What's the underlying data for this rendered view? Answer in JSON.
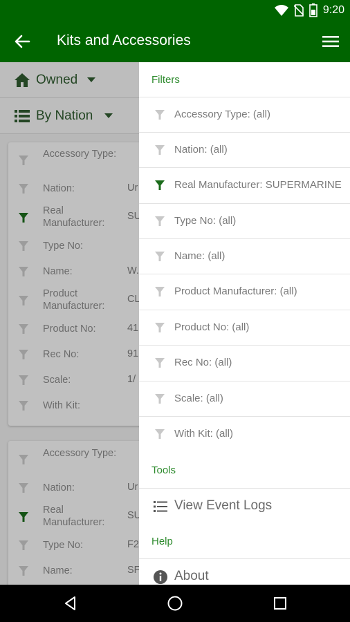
{
  "status_bar": {
    "time": "9:20"
  },
  "app_bar": {
    "title": "Kits and Accessories"
  },
  "page": {
    "owned_label": "Owned",
    "by_nation_label": "By Nation",
    "cards": [
      {
        "rows": [
          {
            "label": "Accessory Type:",
            "value": ""
          },
          {
            "label": "Nation:",
            "value": "Ur"
          },
          {
            "label": "Real Manufacturer:",
            "value": "SU"
          },
          {
            "label": "Type No:",
            "value": ""
          },
          {
            "label": "Name:",
            "value": "W."
          },
          {
            "label": "Product Manufacturer:",
            "value": "CL"
          },
          {
            "label": "Product No:",
            "value": "41"
          },
          {
            "label": "Rec No:",
            "value": "91"
          },
          {
            "label": "Scale:",
            "value": "1/"
          },
          {
            "label": "With Kit:",
            "value": ""
          }
        ]
      },
      {
        "rows": [
          {
            "label": "Accessory Type:",
            "value": ""
          },
          {
            "label": "Nation:",
            "value": "Ur"
          },
          {
            "label": "Real Manufacturer:",
            "value": "SU"
          },
          {
            "label": "Type No:",
            "value": "F2"
          },
          {
            "label": "Name:",
            "value": "SF"
          }
        ]
      }
    ]
  },
  "drawer": {
    "filters_header": "Filters",
    "filters": [
      {
        "label": "Accessory Type: (all)",
        "active": false
      },
      {
        "label": "Nation: (all)",
        "active": false
      },
      {
        "label": "Real Manufacturer: SUPERMARINE",
        "active": true
      },
      {
        "label": "Type No: (all)",
        "active": false
      },
      {
        "label": "Name: (all)",
        "active": false
      },
      {
        "label": "Product Manufacturer: (all)",
        "active": false
      },
      {
        "label": "Product No: (all)",
        "active": false
      },
      {
        "label": "Rec No: (all)",
        "active": false
      },
      {
        "label": "Scale: (all)",
        "active": false
      },
      {
        "label": "With Kit: (all)",
        "active": false
      }
    ],
    "tools_header": "Tools",
    "view_event_logs": "View Event Logs",
    "help_header": "Help",
    "about": "About"
  },
  "colors": {
    "app_bar": "#006400",
    "accent": "#2e8b2e",
    "filter_active": "#1b6b1b",
    "filter_inactive": "#c8c8c8"
  },
  "icons": [
    "back-arrow-icon",
    "hamburger-menu-icon",
    "home-icon",
    "list-icon",
    "filter-icon",
    "info-icon",
    "wifi-icon",
    "no-sim-icon",
    "battery-icon"
  ]
}
